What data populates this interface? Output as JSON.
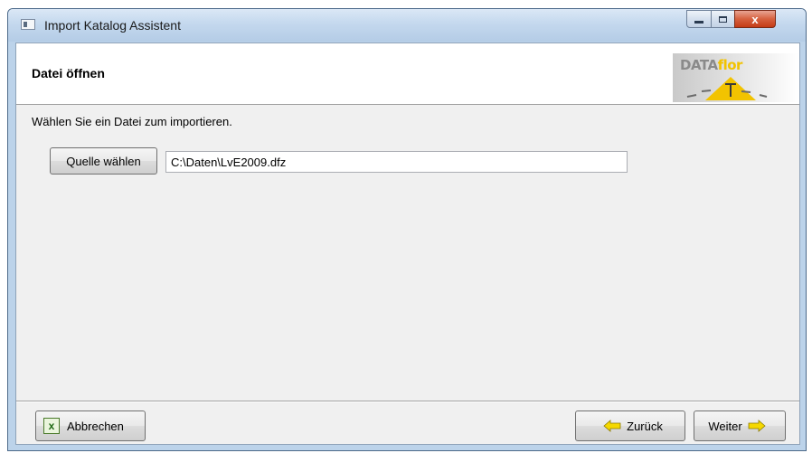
{
  "window": {
    "title": "Import Katalog Assistent",
    "controls": {
      "minimize": "minimize",
      "maximize": "maximize",
      "close": "x"
    }
  },
  "header": {
    "title": "Datei öffnen",
    "logo": {
      "part1": "DATA",
      "part2": "flor"
    }
  },
  "body": {
    "instruction": "Wählen Sie ein Datei zum importieren.",
    "source_button": "Quelle wählen",
    "path_value": "C:\\Daten\\LvE2009.dfz"
  },
  "footer": {
    "cancel_label": "Abbrechen",
    "back_label": "Zurück",
    "next_label": "Weiter"
  },
  "icons": {
    "app": "app-window-icon",
    "cancel": "excel-cancel-icon",
    "back": "arrow-left-icon",
    "next": "arrow-right-icon"
  },
  "colors": {
    "arrow_yellow": "#f5d800",
    "logo_accent": "#f2c300",
    "close_red": "#c43b16"
  }
}
